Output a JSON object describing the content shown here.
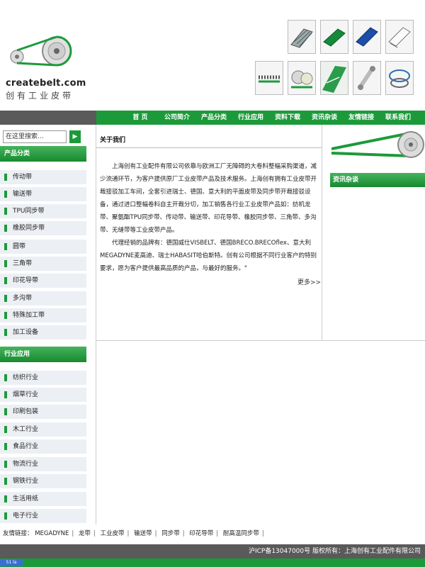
{
  "brand": {
    "domain": "createbelt.com",
    "name_cn": "创有工业皮带"
  },
  "header": {
    "thumbs": [
      "modular-belt-icon",
      "green-belt-icon",
      "blue-belt-icon",
      "white-belt-icon",
      "timing-belt-icon",
      "roller-belt-icon",
      "green-conveyor-icon",
      "roll-belt-icon",
      "round-belt-icon"
    ]
  },
  "nav": {
    "items": [
      "首 页",
      "公司简介",
      "产品分类",
      "行业应用",
      "资料下载",
      "资讯杂谈",
      "友情链接",
      "联系我们"
    ]
  },
  "search": {
    "placeholder": "在这里搜索...",
    "button": "▶"
  },
  "sidebar": {
    "products_title": "产品分类",
    "products": [
      "传动带",
      "输送带",
      "TPU同步带",
      "橡胶同步带",
      "圆带",
      "三角带",
      "印花导带",
      "多沟带",
      "特殊加工带",
      "加工设备"
    ],
    "industries_title": "行业应用",
    "industries": [
      "纺织行业",
      "烟草行业",
      "印刷包装",
      "木工行业",
      "食品行业",
      "物流行业",
      "钢铁行业",
      "生活用纸",
      "电子行业"
    ]
  },
  "about": {
    "title": "关于我们",
    "p1": "上海创有工业配件有限公司依靠与欧洲工厂无障碍的大卷料整幅采购渠道，减少流通环节，为客户提供原厂工业皮带产品及技术服务。上海创有拥有工业皮带开裁接驳加工车间，全套引进瑞士、德国、意大利的平面皮带及同步带开裁接驳设备，通过进口整幅卷料自主开裁分切，加工销售各行业工业皮带产品如：纺机龙带、聚氨酯TPU同步带、传动带、输送带、印花导带、橡胶同步带、三角带、多沟带、无缝带等工业皮带产品。",
    "p2": "代理经销的品牌有：德国威仕VISBELT、德国BRECO.BRECOflex、意大利MEGADYNE麦高迪、瑞士HABASIT哈伯斯特。创有公司根据不同行业客户的特别要求，愿为客户提供最高品质的产品，与最好的服务。\"",
    "more": "更多>>"
  },
  "right": {
    "news_title": "资讯杂谈"
  },
  "friend_links": {
    "label": "友情链接：",
    "items": [
      "MEGADYNE",
      "龙带",
      "工业皮带",
      "输送带",
      "同步带",
      "印花导带",
      "耐高温同步带"
    ]
  },
  "footer": {
    "text": "沪ICP备13047000号 版权所有：上海创有工业配件有限公司",
    "badge": "51 la"
  },
  "colors": {
    "green": "#1c9a3a",
    "gray": "#5a5a5a",
    "item_bg": "#eceff4"
  }
}
